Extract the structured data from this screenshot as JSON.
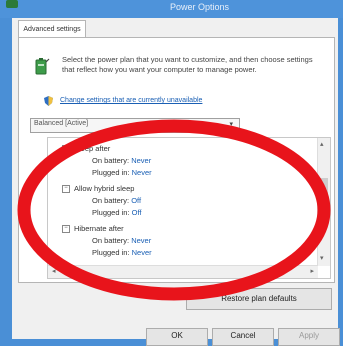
{
  "window": {
    "title": "Power Options"
  },
  "tabs": [
    {
      "label": "Advanced settings"
    }
  ],
  "description": "Select the power plan that you want to customize, and then choose settings that reflect how you want your computer to manage power.",
  "change_link": "Change settings that are currently unavailable",
  "plan_select": {
    "value": "Balanced [Active]"
  },
  "tree": {
    "items": [
      {
        "expander": "−",
        "label": "Sleep after"
      },
      {
        "label": "On battery:",
        "value": "Never"
      },
      {
        "label": "Plugged in:",
        "value": "Never"
      },
      {
        "expander": "−",
        "label": "Allow hybrid sleep"
      },
      {
        "label": "On battery:",
        "value": "Off"
      },
      {
        "label": "Plugged in:",
        "value": "Off"
      },
      {
        "expander": "−",
        "label": "Hibernate after"
      },
      {
        "label": "On battery:",
        "value": "Never"
      },
      {
        "label": "Plugged in:",
        "value": "Never"
      }
    ]
  },
  "buttons": {
    "restore": "Restore plan defaults",
    "ok": "OK",
    "cancel": "Cancel",
    "apply": "Apply"
  },
  "colors": {
    "annotation": "#e8141b",
    "link": "#1a5fb4"
  },
  "icons": {
    "plan": "battery-plug-icon",
    "shield": "uac-shield-icon"
  }
}
